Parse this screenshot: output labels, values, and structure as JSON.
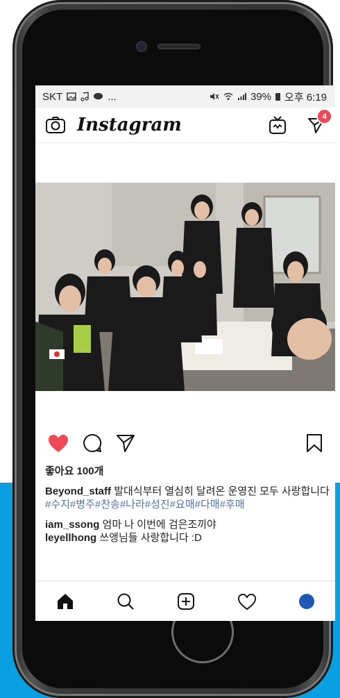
{
  "status_bar": {
    "carrier": "SKT",
    "extra": "...",
    "battery": "39%",
    "time": "오후 6:19"
  },
  "header": {
    "logo_text": "Instagram",
    "dm_badge": "4"
  },
  "post": {
    "likes": "좋아요 100개",
    "caption_user": "Beyond_staff",
    "caption_text": " 발대식부터 열심히 달려온 운영진 모두 사랑합니다 ",
    "caption_tags": "#수지#병주#찬송#나라#성진#요매#다매#후매",
    "comments": [
      {
        "user": "iam_ssong",
        "text": " 엄마 나 이번에 검은조끼야"
      },
      {
        "user": "leyellhong",
        "text": " 쓰앵님들 사랑합니다 :D"
      }
    ]
  },
  "colors": {
    "like_red": "#ed4956",
    "tag_blue": "#5474a8",
    "background_blue": "#0a9fe0",
    "avatar": "#1e57b4"
  },
  "icons": {
    "header_left": "camera-icon",
    "header_right": [
      "igtv-icon",
      "direct-message-icon"
    ],
    "actions": [
      "heart-filled-icon",
      "comment-icon",
      "share-icon",
      "bookmark-icon"
    ],
    "tabs": [
      "home-icon",
      "search-icon",
      "add-post-icon",
      "activity-heart-icon",
      "profile-avatar"
    ]
  }
}
